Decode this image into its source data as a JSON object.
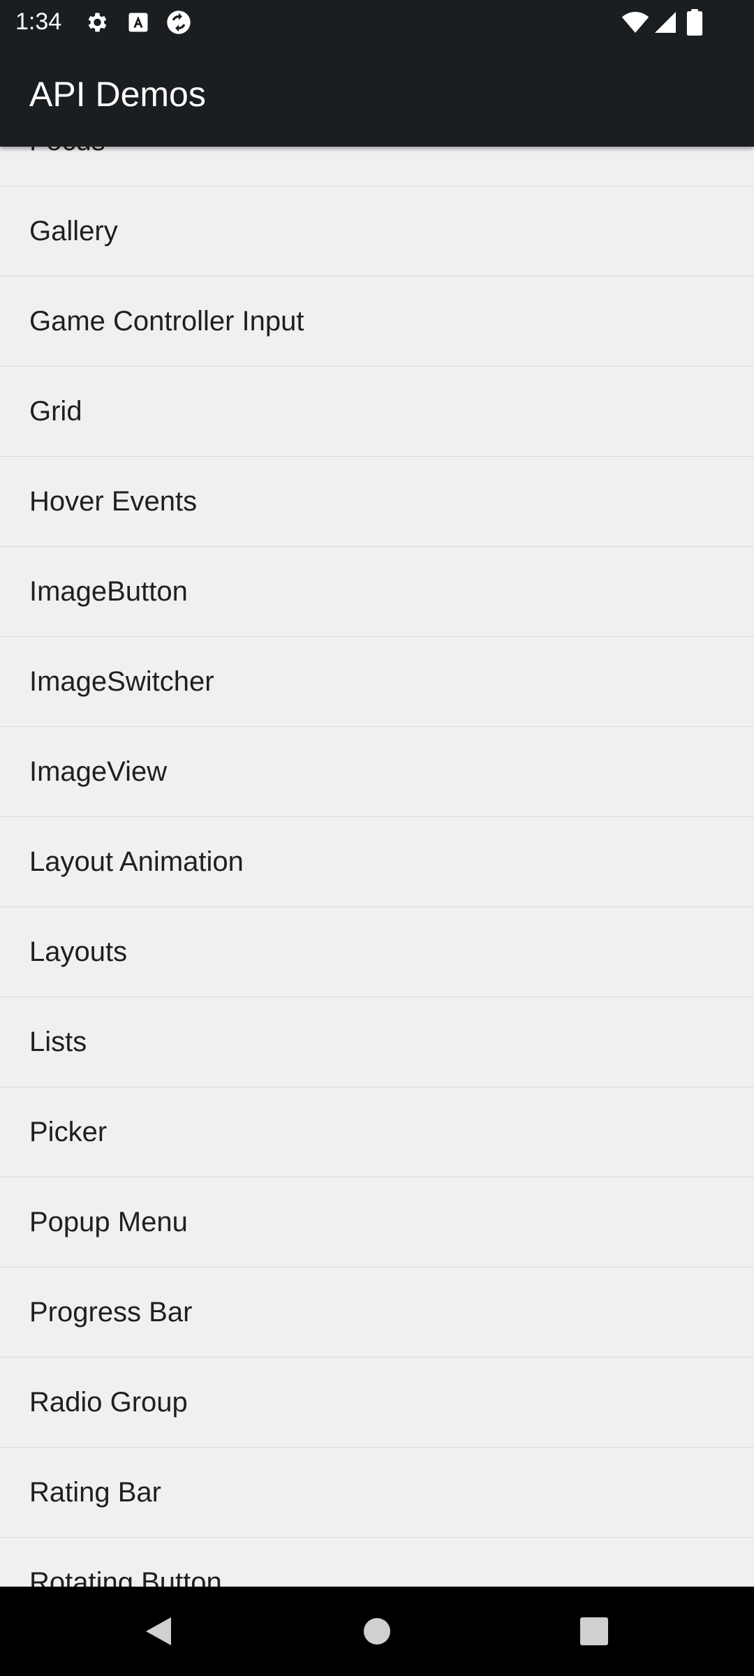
{
  "status_bar": {
    "time": "1:34",
    "left_icons": [
      "settings-icon",
      "a-letter-icon",
      "sync-icon"
    ],
    "right_icons": [
      "wifi-icon",
      "cell-signal-icon",
      "battery-icon"
    ]
  },
  "app_bar": {
    "title": "API Demos"
  },
  "list": {
    "items": [
      {
        "label": "Focus"
      },
      {
        "label": "Gallery"
      },
      {
        "label": "Game Controller Input"
      },
      {
        "label": "Grid"
      },
      {
        "label": "Hover Events"
      },
      {
        "label": "ImageButton"
      },
      {
        "label": "ImageSwitcher"
      },
      {
        "label": "ImageView"
      },
      {
        "label": "Layout Animation"
      },
      {
        "label": "Layouts"
      },
      {
        "label": "Lists"
      },
      {
        "label": "Picker"
      },
      {
        "label": "Popup Menu"
      },
      {
        "label": "Progress Bar"
      },
      {
        "label": "Radio Group"
      },
      {
        "label": "Rating Bar"
      },
      {
        "label": "Rotating Button"
      }
    ]
  },
  "nav_bar": {
    "buttons": [
      "back-icon",
      "home-icon",
      "recents-icon"
    ]
  },
  "colors": {
    "bar_background": "#1b1e21",
    "list_background": "#f0f0f2",
    "divider": "#d8d8da",
    "text": "#1f1f1f"
  }
}
